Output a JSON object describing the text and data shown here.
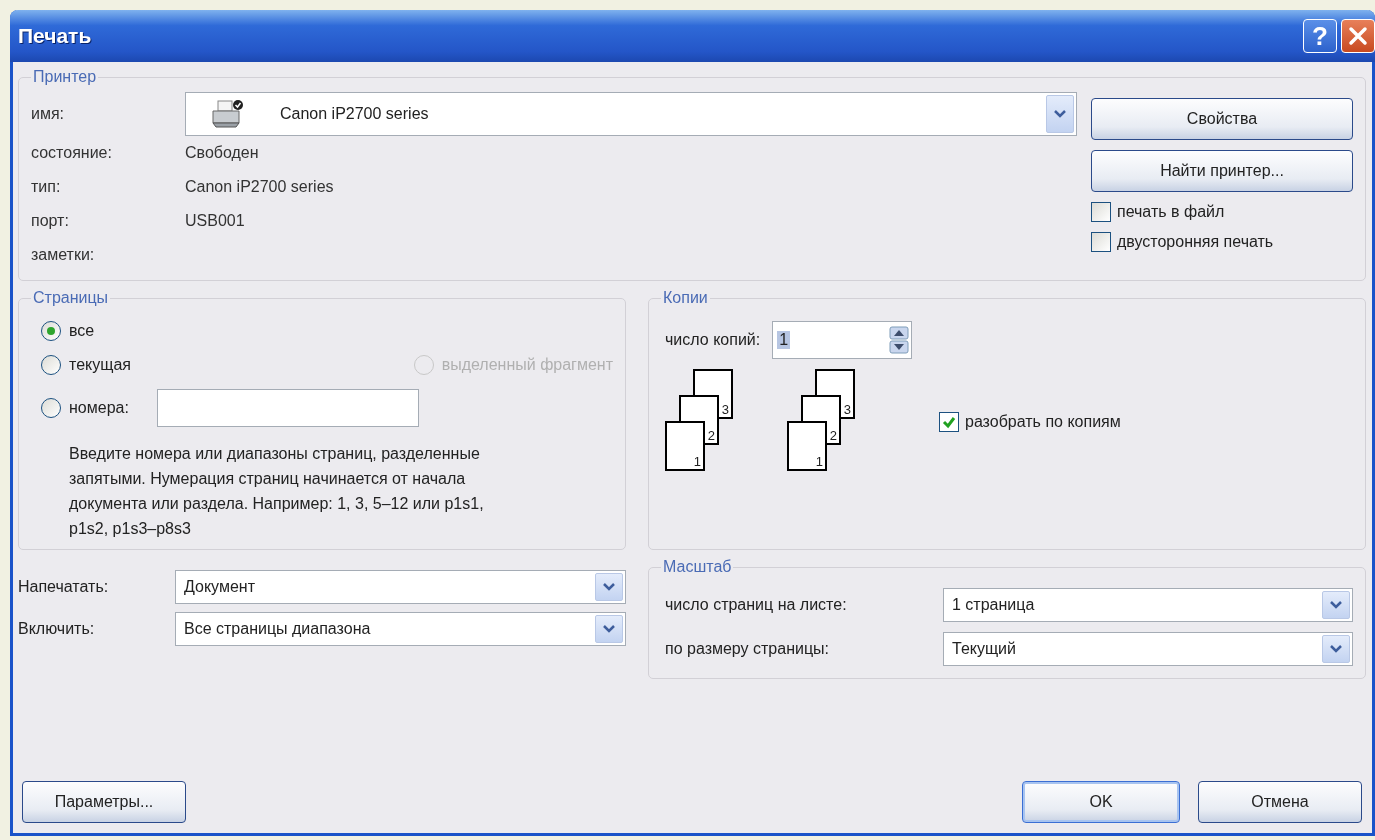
{
  "window": {
    "title": "Печать",
    "help": "?"
  },
  "printer": {
    "legend": "Принтер",
    "name_label": "имя:",
    "name_value": "Canon iP2700 series",
    "info": [
      {
        "label": "состояние:",
        "value": "Свободен"
      },
      {
        "label": "тип:",
        "value": "Canon iP2700 series"
      },
      {
        "label": "порт:",
        "value": "USB001"
      },
      {
        "label": "заметки:"
      }
    ],
    "buttons": [
      "Свойства",
      "Найти принтер..."
    ],
    "options": [
      {
        "label": "печать в файл",
        "checked": false
      },
      {
        "label": "двусторонняя печать",
        "checked": false
      }
    ]
  },
  "pages": {
    "legend": "Страницы",
    "options": [
      {
        "label": "все",
        "selected": true,
        "disabled": false
      },
      {
        "label": "текущая",
        "selected": false,
        "disabled": false
      },
      {
        "label": "выделенный фрагмент",
        "selected": false,
        "disabled": true
      },
      {
        "label": "номера:",
        "selected": false,
        "disabled": false
      }
    ],
    "hint": "Введите номера или диапазоны страниц, разделенные запятыми. Нумерация страниц начинается от начала документа или раздела. Например: 1, 3, 5–12 или p1s1, p1s2, p1s3–p8s3"
  },
  "copies": {
    "legend": "Копии",
    "count_label": "число копий:",
    "count_value": "1",
    "stacks": [
      {
        "pages": [
          "1",
          "2",
          "3"
        ]
      },
      {
        "pages": [
          "1",
          "2",
          "3"
        ]
      }
    ],
    "collate": {
      "label": "разобрать по копиям",
      "checked": true
    }
  },
  "print_what": [
    {
      "label": "Напечатать:",
      "value": "Документ"
    },
    {
      "label": "Включить:",
      "value": "Все страницы диапазона"
    }
  ],
  "scale": {
    "legend": "Масштаб",
    "rows": [
      {
        "label": "число страниц на листе:",
        "value": "1 страница"
      },
      {
        "label": "по размеру страницы:",
        "value": "Текущий"
      }
    ]
  },
  "footer": {
    "options_button": "Параметры...",
    "ok": "OK",
    "cancel": "Отмена"
  }
}
